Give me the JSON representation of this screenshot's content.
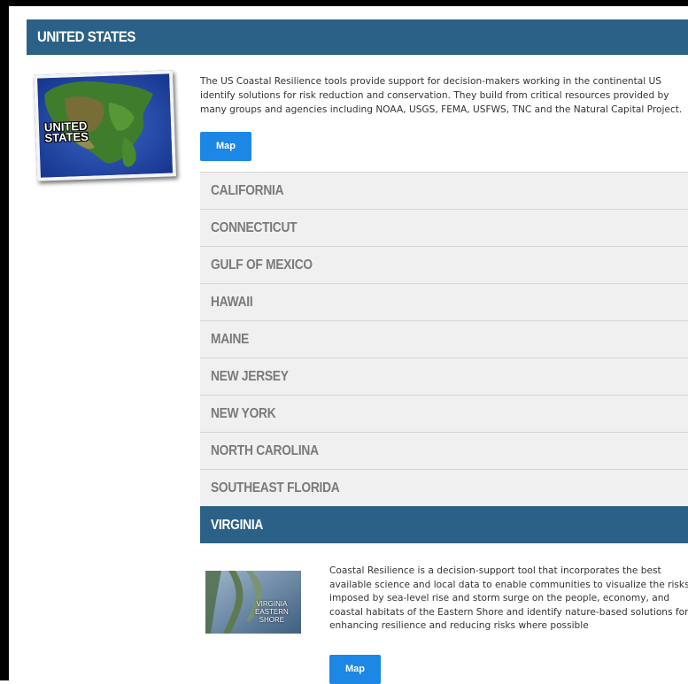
{
  "header": {
    "title": "UNITED STATES"
  },
  "us_section": {
    "image_label": "UNITED\nSTATES",
    "description": "The US Coastal Resilience tools provide support for decision-makers working in the continental US identify solutions for risk reduction and conservation. They build from critical resources provided by many groups and agencies including NOAA, USGS, FEMA, USFWS, TNC and the Natural Capital Project.",
    "map_button": "Map"
  },
  "regions": [
    {
      "label": "CALIFORNIA",
      "expanded": false
    },
    {
      "label": "CONNECTICUT",
      "expanded": false
    },
    {
      "label": "GULF OF MEXICO",
      "expanded": false
    },
    {
      "label": "HAWAII",
      "expanded": false
    },
    {
      "label": "MAINE",
      "expanded": false
    },
    {
      "label": "NEW JERSEY",
      "expanded": false
    },
    {
      "label": "NEW YORK",
      "expanded": false
    },
    {
      "label": "NORTH CAROLINA",
      "expanded": false
    },
    {
      "label": "SOUTHEAST FLORIDA",
      "expanded": false
    },
    {
      "label": "VIRGINIA",
      "expanded": true
    }
  ],
  "virginia": {
    "image_label": "VIRGINIA\nEASTERN\nSHORE",
    "description": "Coastal Resilience is a decision-support tool that incorporates the best available science and local data to enable communities to visualize the risks imposed by sea-level rise and storm surge on the people, economy, and coastal habitats of the Eastern Shore and identify nature-based solutions for enhancing resilience and reducing risks where possible",
    "map_button": "Map"
  },
  "colors": {
    "header_bg": "#2b6187",
    "button_bg": "#1c87e5",
    "list_bg": "#f0f0f0",
    "list_text": "#7a7a7a"
  }
}
